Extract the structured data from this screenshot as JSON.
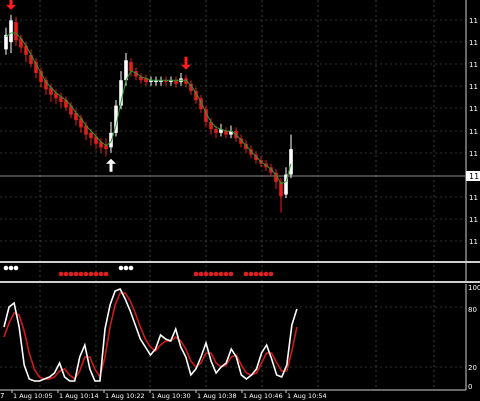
{
  "main_chart": {
    "price_axis_labels": [
      "11",
      "11",
      "11",
      "11",
      "11",
      "11",
      "11",
      "11",
      "11",
      "11",
      "11",
      "11"
    ],
    "current_price_label": "11",
    "bar_count": 60,
    "candles": [
      {
        "o": 1.23,
        "c": 1.15,
        "h": 1.27,
        "l": 1.12,
        "color": "white"
      },
      {
        "o": 1.19,
        "c": 1.31,
        "h": 1.34,
        "l": 1.13,
        "color": "white"
      },
      {
        "o": 1.3,
        "c": 1.2,
        "h": 1.33,
        "l": 1.17,
        "color": "red"
      },
      {
        "o": 1.21,
        "c": 1.16,
        "h": 1.23,
        "l": 1.13,
        "color": "red"
      },
      {
        "o": 1.17,
        "c": 1.12,
        "h": 1.19,
        "l": 1.08,
        "color": "red"
      },
      {
        "o": 1.12,
        "c": 1.07,
        "h": 1.15,
        "l": 1.05,
        "color": "red"
      },
      {
        "o": 1.08,
        "c": 1.02,
        "h": 1.1,
        "l": 0.99,
        "color": "red"
      },
      {
        "o": 1.03,
        "c": 0.97,
        "h": 1.05,
        "l": 0.94,
        "color": "red"
      },
      {
        "o": 0.98,
        "c": 0.93,
        "h": 1.0,
        "l": 0.9,
        "color": "red"
      },
      {
        "o": 0.94,
        "c": 0.9,
        "h": 0.96,
        "l": 0.86,
        "color": "red"
      },
      {
        "o": 0.91,
        "c": 0.88,
        "h": 0.93,
        "l": 0.85,
        "color": "red"
      },
      {
        "o": 0.89,
        "c": 0.86,
        "h": 0.91,
        "l": 0.83,
        "color": "red"
      },
      {
        "o": 0.87,
        "c": 0.83,
        "h": 0.89,
        "l": 0.81,
        "color": "red"
      },
      {
        "o": 0.84,
        "c": 0.79,
        "h": 0.86,
        "l": 0.77,
        "color": "red"
      },
      {
        "o": 0.8,
        "c": 0.76,
        "h": 0.82,
        "l": 0.73,
        "color": "red"
      },
      {
        "o": 0.77,
        "c": 0.72,
        "h": 0.79,
        "l": 0.69,
        "color": "red"
      },
      {
        "o": 0.73,
        "c": 0.68,
        "h": 0.75,
        "l": 0.65,
        "color": "red"
      },
      {
        "o": 0.69,
        "c": 0.66,
        "h": 0.71,
        "l": 0.62,
        "color": "red"
      },
      {
        "o": 0.67,
        "c": 0.63,
        "h": 0.69,
        "l": 0.6,
        "color": "red"
      },
      {
        "o": 0.64,
        "c": 0.61,
        "h": 0.66,
        "l": 0.58,
        "color": "red"
      },
      {
        "o": 0.62,
        "c": 0.6,
        "h": 0.66,
        "l": 0.56,
        "color": "red"
      },
      {
        "o": 0.61,
        "c": 0.69,
        "h": 0.75,
        "l": 0.58,
        "color": "white"
      },
      {
        "o": 0.69,
        "c": 0.84,
        "h": 0.87,
        "l": 0.67,
        "color": "white"
      },
      {
        "o": 0.84,
        "c": 0.98,
        "h": 1.03,
        "l": 0.82,
        "color": "white"
      },
      {
        "o": 0.98,
        "c": 1.09,
        "h": 1.13,
        "l": 0.95,
        "color": "white"
      },
      {
        "o": 1.08,
        "c": 1.03,
        "h": 1.1,
        "l": 1.0,
        "color": "red"
      },
      {
        "o": 1.03,
        "c": 1.0,
        "h": 1.05,
        "l": 0.98,
        "color": "red"
      },
      {
        "o": 1.0,
        "c": 0.98,
        "h": 1.02,
        "l": 0.96,
        "color": "red"
      },
      {
        "o": 0.99,
        "c": 0.97,
        "h": 1.01,
        "l": 0.95,
        "color": "red"
      },
      {
        "o": 0.97,
        "c": 0.98,
        "h": 1.0,
        "l": 0.95,
        "color": "white"
      },
      {
        "o": 0.98,
        "c": 0.97,
        "h": 1.0,
        "l": 0.95,
        "color": "white"
      },
      {
        "o": 0.97,
        "c": 0.98,
        "h": 1.0,
        "l": 0.95,
        "color": "white"
      },
      {
        "o": 0.98,
        "c": 0.97,
        "h": 1.0,
        "l": 0.95,
        "color": "red"
      },
      {
        "o": 0.97,
        "c": 0.98,
        "h": 1.0,
        "l": 0.95,
        "color": "white"
      },
      {
        "o": 0.98,
        "c": 0.96,
        "h": 1.0,
        "l": 0.94,
        "color": "red"
      },
      {
        "o": 0.97,
        "c": 0.99,
        "h": 1.02,
        "l": 0.95,
        "color": "white"
      },
      {
        "o": 0.99,
        "c": 0.96,
        "h": 1.01,
        "l": 0.94,
        "color": "red"
      },
      {
        "o": 0.96,
        "c": 0.92,
        "h": 0.98,
        "l": 0.9,
        "color": "red"
      },
      {
        "o": 0.92,
        "c": 0.87,
        "h": 0.94,
        "l": 0.85,
        "color": "red"
      },
      {
        "o": 0.88,
        "c": 0.82,
        "h": 0.9,
        "l": 0.8,
        "color": "red"
      },
      {
        "o": 0.82,
        "c": 0.75,
        "h": 0.84,
        "l": 0.72,
        "color": "red"
      },
      {
        "o": 0.75,
        "c": 0.71,
        "h": 0.77,
        "l": 0.68,
        "color": "red"
      },
      {
        "o": 0.71,
        "c": 0.69,
        "h": 0.73,
        "l": 0.66,
        "color": "red"
      },
      {
        "o": 0.69,
        "c": 0.71,
        "h": 0.74,
        "l": 0.67,
        "color": "white"
      },
      {
        "o": 0.7,
        "c": 0.68,
        "h": 0.72,
        "l": 0.66,
        "color": "red"
      },
      {
        "o": 0.68,
        "c": 0.7,
        "h": 0.73,
        "l": 0.66,
        "color": "white"
      },
      {
        "o": 0.7,
        "c": 0.66,
        "h": 0.72,
        "l": 0.64,
        "color": "red"
      },
      {
        "o": 0.66,
        "c": 0.63,
        "h": 0.68,
        "l": 0.61,
        "color": "red"
      },
      {
        "o": 0.63,
        "c": 0.6,
        "h": 0.65,
        "l": 0.58,
        "color": "red"
      },
      {
        "o": 0.6,
        "c": 0.57,
        "h": 0.62,
        "l": 0.55,
        "color": "red"
      },
      {
        "o": 0.57,
        "c": 0.54,
        "h": 0.59,
        "l": 0.52,
        "color": "red"
      },
      {
        "o": 0.54,
        "c": 0.52,
        "h": 0.56,
        "l": 0.5,
        "color": "red"
      },
      {
        "o": 0.52,
        "c": 0.5,
        "h": 0.54,
        "l": 0.48,
        "color": "red"
      },
      {
        "o": 0.5,
        "c": 0.47,
        "h": 0.52,
        "l": 0.45,
        "color": "red"
      },
      {
        "o": 0.47,
        "c": 0.42,
        "h": 0.49,
        "l": 0.38,
        "color": "red"
      },
      {
        "o": 0.42,
        "c": 0.34,
        "h": 0.44,
        "l": 0.25,
        "color": "red"
      },
      {
        "o": 0.35,
        "c": 0.46,
        "h": 0.5,
        "l": 0.33,
        "color": "white"
      },
      {
        "o": 0.46,
        "c": 0.6,
        "h": 0.68,
        "l": 0.44,
        "color": "white"
      }
    ],
    "moving_average": [
      1.22,
      1.24,
      1.24,
      1.21,
      1.17,
      1.12,
      1.07,
      1.02,
      0.97,
      0.94,
      0.91,
      0.89,
      0.87,
      0.84,
      0.8,
      0.77,
      0.73,
      0.7,
      0.67,
      0.64,
      0.62,
      0.64,
      0.73,
      0.86,
      0.98,
      1.03,
      1.02,
      1.0,
      0.99,
      0.98,
      0.98,
      0.98,
      0.98,
      0.98,
      0.98,
      0.98,
      0.98,
      0.95,
      0.91,
      0.86,
      0.8,
      0.75,
      0.72,
      0.71,
      0.7,
      0.7,
      0.68,
      0.65,
      0.62,
      0.59,
      0.56,
      0.53,
      0.51,
      0.49,
      0.46,
      0.41,
      0.42,
      0.52
    ],
    "signal_arrows": [
      {
        "bar": 1,
        "type": "down",
        "color": "#ff1e1e"
      },
      {
        "bar": 21,
        "type": "up",
        "color": "#ffffff"
      },
      {
        "bar": 36,
        "type": "down",
        "color": "#ff1e1e"
      }
    ]
  },
  "signal_strip": {
    "dots": [
      {
        "bar": 0,
        "color": "white"
      },
      {
        "bar": 1,
        "color": "white"
      },
      {
        "bar": 2,
        "color": "white"
      },
      {
        "bar": 11,
        "color": "red"
      },
      {
        "bar": 12,
        "color": "red"
      },
      {
        "bar": 13,
        "color": "red"
      },
      {
        "bar": 14,
        "color": "red"
      },
      {
        "bar": 15,
        "color": "red"
      },
      {
        "bar": 16,
        "color": "red"
      },
      {
        "bar": 17,
        "color": "red"
      },
      {
        "bar": 18,
        "color": "red"
      },
      {
        "bar": 19,
        "color": "red"
      },
      {
        "bar": 20,
        "color": "red"
      },
      {
        "bar": 23,
        "color": "white"
      },
      {
        "bar": 24,
        "color": "white"
      },
      {
        "bar": 25,
        "color": "white"
      },
      {
        "bar": 38,
        "color": "red"
      },
      {
        "bar": 39,
        "color": "red"
      },
      {
        "bar": 40,
        "color": "red"
      },
      {
        "bar": 41,
        "color": "red"
      },
      {
        "bar": 42,
        "color": "red"
      },
      {
        "bar": 43,
        "color": "red"
      },
      {
        "bar": 44,
        "color": "red"
      },
      {
        "bar": 45,
        "color": "red"
      },
      {
        "bar": 48,
        "color": "red"
      },
      {
        "bar": 49,
        "color": "red"
      },
      {
        "bar": 50,
        "color": "red"
      },
      {
        "bar": 51,
        "color": "red"
      },
      {
        "bar": 52,
        "color": "red"
      },
      {
        "bar": 53,
        "color": "red"
      }
    ]
  },
  "oscillator": {
    "levels": [
      "80",
      "20"
    ],
    "axis_top_label": "100",
    "axis_bottom_label": "0",
    "main_line": [
      60,
      80,
      84,
      60,
      22,
      8,
      6,
      6,
      8,
      10,
      14,
      24,
      10,
      6,
      6,
      30,
      42,
      18,
      6,
      6,
      58,
      82,
      96,
      98,
      88,
      76,
      62,
      48,
      40,
      32,
      38,
      52,
      48,
      46,
      58,
      40,
      30,
      12,
      18,
      30,
      44,
      26,
      14,
      20,
      24,
      38,
      30,
      12,
      8,
      12,
      18,
      34,
      42,
      28,
      12,
      10,
      22,
      62,
      78
    ],
    "signal_line": [
      50,
      64,
      74,
      72,
      56,
      34,
      18,
      10,
      8,
      8,
      10,
      16,
      18,
      12,
      8,
      16,
      30,
      30,
      18,
      10,
      30,
      60,
      82,
      94,
      94,
      86,
      74,
      60,
      48,
      40,
      36,
      42,
      46,
      46,
      50,
      46,
      38,
      26,
      20,
      24,
      34,
      34,
      24,
      20,
      22,
      30,
      32,
      22,
      14,
      12,
      14,
      24,
      34,
      34,
      24,
      16,
      16,
      36,
      60
    ]
  },
  "time_axis": {
    "labels": [
      "1 Aug 10:05",
      "1 Aug 10:14",
      "1 Aug 10:22",
      "1 Aug 10:30",
      "1 Aug 10:38",
      "1 Aug 10:46",
      "1 Aug 10:54"
    ],
    "edge_label": "7"
  },
  "colors": {
    "background": "#000000",
    "grid": "#5a6a5a",
    "bull_candle": "#ffffff",
    "bear_candle": "#e31e1e",
    "moving_average": "#2e9a2e",
    "oscillator_main": "#ffffff",
    "oscillator_signal": "#d11a1a",
    "separator": "#cfcfcf"
  }
}
